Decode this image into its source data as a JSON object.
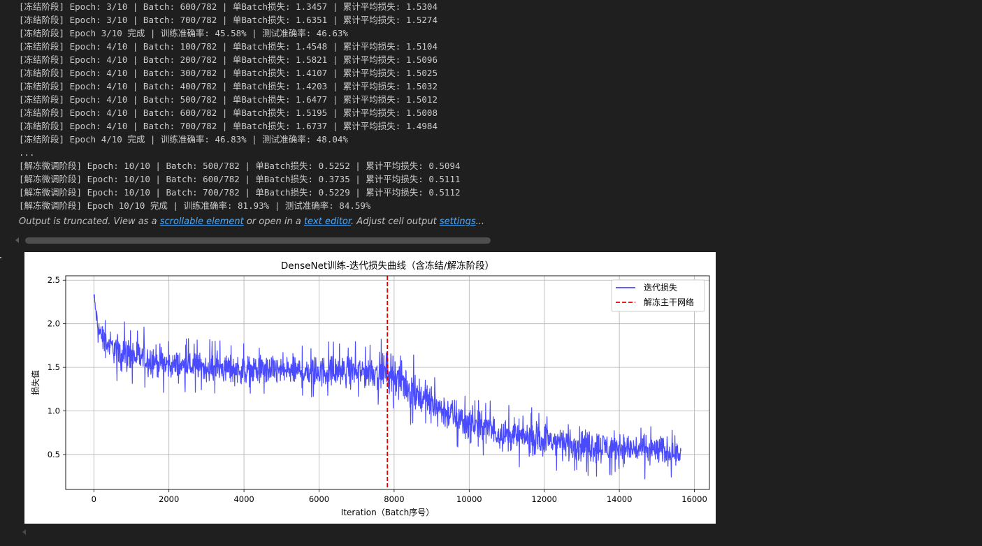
{
  "output_log": [
    "[冻结阶段] Epoch: 3/10 | Batch: 600/782 | 单Batch损失: 1.3457 | 累计平均损失: 1.5304",
    "[冻结阶段] Epoch: 3/10 | Batch: 700/782 | 单Batch损失: 1.6351 | 累计平均损失: 1.5274",
    "[冻结阶段] Epoch 3/10 完成 | 训练准确率: 45.58% | 测试准确率: 46.63%",
    "[冻结阶段] Epoch: 4/10 | Batch: 100/782 | 单Batch损失: 1.4548 | 累计平均损失: 1.5104",
    "[冻结阶段] Epoch: 4/10 | Batch: 200/782 | 单Batch损失: 1.5821 | 累计平均损失: 1.5096",
    "[冻结阶段] Epoch: 4/10 | Batch: 300/782 | 单Batch损失: 1.4107 | 累计平均损失: 1.5025",
    "[冻结阶段] Epoch: 4/10 | Batch: 400/782 | 单Batch损失: 1.4203 | 累计平均损失: 1.5032",
    "[冻结阶段] Epoch: 4/10 | Batch: 500/782 | 单Batch损失: 1.6477 | 累计平均损失: 1.5012",
    "[冻结阶段] Epoch: 4/10 | Batch: 600/782 | 单Batch损失: 1.5195 | 累计平均损失: 1.5008",
    "[冻结阶段] Epoch: 4/10 | Batch: 700/782 | 单Batch损失: 1.6737 | 累计平均损失: 1.4984",
    "[冻结阶段] Epoch 4/10 完成 | 训练准确率: 46.83% | 测试准确率: 48.04%",
    "...",
    "[解冻微调阶段] Epoch: 10/10 | Batch: 500/782 | 单Batch损失: 0.5252 | 累计平均损失: 0.5094",
    "[解冻微调阶段] Epoch: 10/10 | Batch: 600/782 | 单Batch损失: 0.3735 | 累计平均损失: 0.5111",
    "[解冻微调阶段] Epoch: 10/10 | Batch: 700/782 | 单Batch损失: 0.5229 | 累计平均损失: 0.5112",
    "[解冻微调阶段] Epoch 10/10 完成 | 训练准确率: 81.93% | 测试准确率: 84.59%"
  ],
  "truncation": {
    "text_before": "Output is truncated. View as a ",
    "link_scrollable": "scrollable element",
    "text_middle": " or open in a ",
    "link_editor": "text editor",
    "text_after": ". Adjust cell output ",
    "link_settings": "settings",
    "text_end": "..."
  },
  "chart_data": {
    "type": "line",
    "title": "DenseNet训练-迭代损失曲线（含冻结/解冻阶段）",
    "xlabel": "Iteration（Batch序号）",
    "ylabel": "损失值",
    "xlim": [
      -750,
      16400
    ],
    "ylim": [
      0.1,
      2.55
    ],
    "xticks": [
      0,
      2000,
      4000,
      6000,
      8000,
      10000,
      12000,
      14000,
      16000
    ],
    "yticks": [
      0.5,
      1.0,
      1.5,
      2.0,
      2.5
    ],
    "xtick_labels": [
      "0",
      "2000",
      "4000",
      "6000",
      "8000",
      "10000",
      "12000",
      "14000",
      "16000"
    ],
    "ytick_labels": [
      "0.5",
      "1.0",
      "1.5",
      "2.0",
      "2.5"
    ],
    "grid": true,
    "legend_placement": "top-right",
    "colors": {
      "loss_line": "#4a4aff",
      "unfreeze_line": "#e00000"
    },
    "series": [
      {
        "name": "迭代损失",
        "style": "solid",
        "x_max": 15640,
        "envelope": [
          {
            "x": 0,
            "low": 2.2,
            "high": 2.45
          },
          {
            "x": 100,
            "low": 1.8,
            "high": 2.15
          },
          {
            "x": 300,
            "low": 1.55,
            "high": 2.02
          },
          {
            "x": 800,
            "low": 1.35,
            "high": 1.95
          },
          {
            "x": 1400,
            "low": 1.3,
            "high": 1.9
          },
          {
            "x": 2000,
            "low": 1.28,
            "high": 1.78
          },
          {
            "x": 3000,
            "low": 1.25,
            "high": 1.75
          },
          {
            "x": 4000,
            "low": 1.22,
            "high": 1.72
          },
          {
            "x": 5000,
            "low": 1.2,
            "high": 1.72
          },
          {
            "x": 6000,
            "low": 1.18,
            "high": 1.72
          },
          {
            "x": 7000,
            "low": 1.18,
            "high": 1.72
          },
          {
            "x": 7800,
            "low": 1.15,
            "high": 1.75
          },
          {
            "x": 7830,
            "low": 1.1,
            "high": 1.85
          },
          {
            "x": 8300,
            "low": 0.95,
            "high": 1.65
          },
          {
            "x": 9000,
            "low": 0.75,
            "high": 1.4
          },
          {
            "x": 10000,
            "low": 0.55,
            "high": 1.15
          },
          {
            "x": 11000,
            "low": 0.45,
            "high": 1.0
          },
          {
            "x": 12000,
            "low": 0.38,
            "high": 0.95
          },
          {
            "x": 13000,
            "low": 0.32,
            "high": 0.9
          },
          {
            "x": 14000,
            "low": 0.3,
            "high": 0.85
          },
          {
            "x": 15000,
            "low": 0.28,
            "high": 0.82
          },
          {
            "x": 15640,
            "low": 0.3,
            "high": 0.75
          }
        ]
      },
      {
        "name": "解冻主干网络",
        "style": "dashed",
        "x": 7820
      }
    ]
  }
}
